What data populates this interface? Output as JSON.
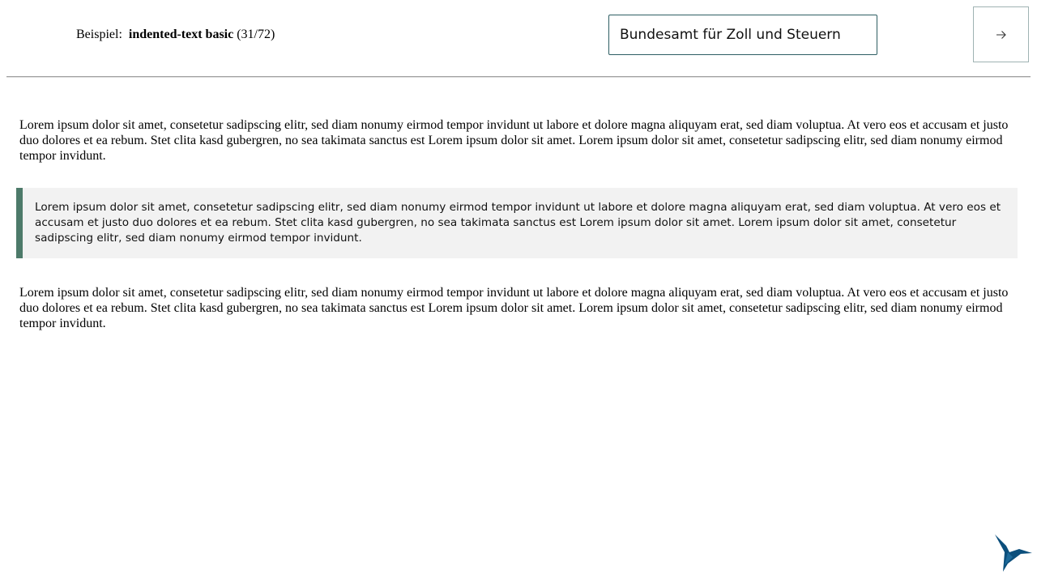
{
  "header": {
    "example_prefix": "Beispiel:",
    "example_name": "indented-text basic",
    "example_counter": "(31/72)",
    "search_value": "Bundesamt für Zoll und Steuern",
    "next_button_icon": "arrow-right-icon"
  },
  "content": {
    "paragraph_1": "Lorem ipsum dolor sit amet, consetetur sadipscing elitr, sed diam nonumy eirmod tempor invidunt ut labore et dolore magna aliquyam erat, sed diam voluptua. At vero eos et accusam et justo duo dolores et ea rebum. Stet clita kasd gubergren, no sea takimata sanctus est Lorem ipsum dolor sit amet. Lorem ipsum dolor sit amet, consetetur sadipscing elitr, sed diam nonumy eirmod tempor invidunt.",
    "indented_text": "Lorem ipsum dolor sit amet, consetetur sadipscing elitr, sed diam nonumy eirmod tempor invidunt ut labore et dolore magna aliquyam erat, sed diam voluptua. At vero eos et accusam et justo duo dolores et ea rebum. Stet clita kasd gubergren, no sea takimata sanctus est Lorem ipsum dolor sit amet. Lorem ipsum dolor sit amet, consetetur sadipscing elitr, sed diam nonumy eirmod tempor invidunt.",
    "paragraph_3": "Lorem ipsum dolor sit amet, consetetur sadipscing elitr, sed diam nonumy eirmod tempor invidunt ut labore et dolore magna aliquyam erat, sed diam voluptua. At vero eos et accusam et justo duo dolores et ea rebum. Stet clita kasd gubergren, no sea takimata sanctus est Lorem ipsum dolor sit amet. Lorem ipsum dolor sit amet, consetetur sadipscing elitr, sed diam nonumy eirmod tempor invidunt."
  },
  "colors": {
    "accent_border": "#4d7a6a",
    "indented_background": "#f2f2f2",
    "search_border": "#2e5e63",
    "logo_blue": "#0b4f7c"
  },
  "logo": {
    "icon": "hummingbird-logo-icon"
  }
}
